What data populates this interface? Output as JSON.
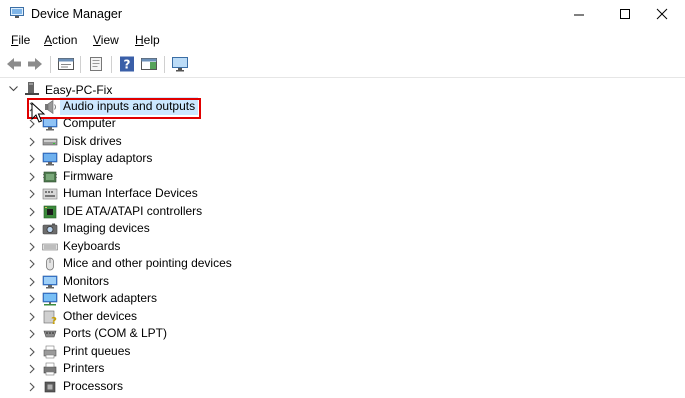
{
  "window": {
    "title": "Device Manager",
    "controls": {
      "minimize": "minimize",
      "maximize": "maximize",
      "close": "close"
    }
  },
  "menu": [
    {
      "label": "File",
      "mnemonic": "F",
      "rest": "ile"
    },
    {
      "label": "Action",
      "mnemonic": "A",
      "rest": "ction"
    },
    {
      "label": "View",
      "mnemonic": "V",
      "rest": "iew"
    },
    {
      "label": "Help",
      "mnemonic": "H",
      "rest": "elp"
    }
  ],
  "toolbar": {
    "buttons": [
      "back-icon",
      "forward-icon",
      "properties-icon",
      "update-driver-icon",
      "help-icon",
      "action-pane-icon",
      "monitor-scan-icon"
    ]
  },
  "tree": {
    "root": "Easy-PC-Fix",
    "selected": "Audio inputs and outputs",
    "categories": [
      {
        "label": "Audio inputs and outputs",
        "icon": "speaker-icon"
      },
      {
        "label": "Computer",
        "icon": "computer-icon"
      },
      {
        "label": "Disk drives",
        "icon": "disk-drive-icon"
      },
      {
        "label": "Display adaptors",
        "icon": "display-adapter-icon"
      },
      {
        "label": "Firmware",
        "icon": "firmware-icon"
      },
      {
        "label": "Human Interface Devices",
        "icon": "hid-icon"
      },
      {
        "label": "IDE ATA/ATAPI controllers",
        "icon": "ide-controller-icon"
      },
      {
        "label": "Imaging devices",
        "icon": "camera-icon"
      },
      {
        "label": "Keyboards",
        "icon": "keyboard-icon"
      },
      {
        "label": "Mice and other pointing devices",
        "icon": "mouse-icon"
      },
      {
        "label": "Monitors",
        "icon": "monitor-icon"
      },
      {
        "label": "Network adapters",
        "icon": "network-icon"
      },
      {
        "label": "Other devices",
        "icon": "other-devices-icon"
      },
      {
        "label": "Ports (COM & LPT)",
        "icon": "port-icon"
      },
      {
        "label": "Print queues",
        "icon": "print-queue-icon"
      },
      {
        "label": "Printers",
        "icon": "printer-icon"
      },
      {
        "label": "Processors",
        "icon": "processor-icon"
      }
    ]
  },
  "colors": {
    "selection": "#cce8ff",
    "highlight": "#e00000"
  }
}
